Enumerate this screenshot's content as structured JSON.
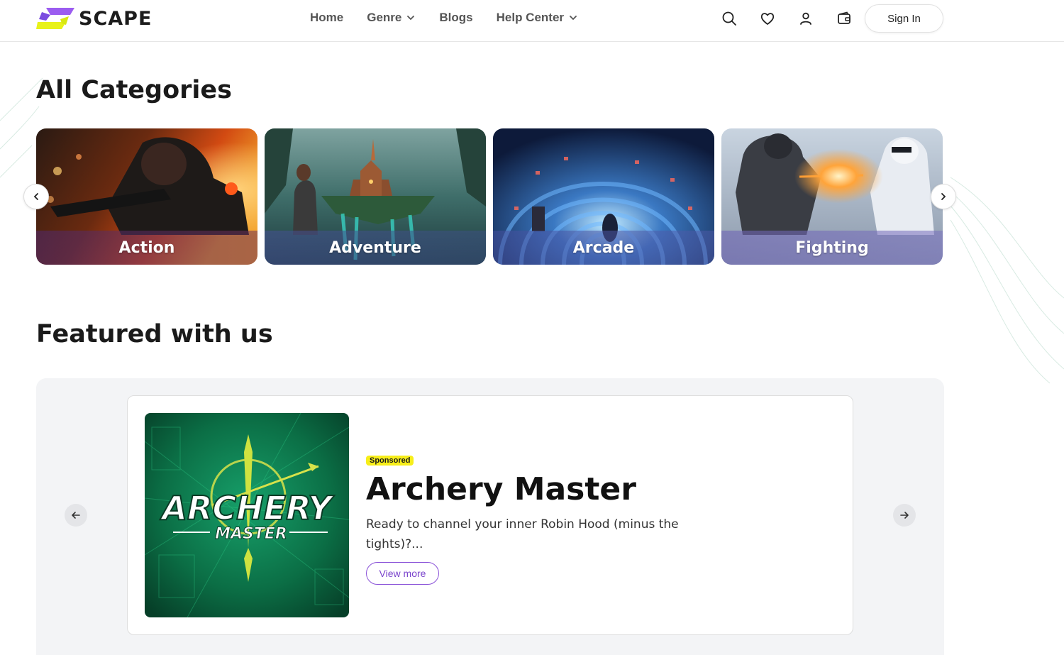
{
  "header": {
    "logo_text": "SCAPE",
    "nav": [
      {
        "label": "Home",
        "has_dropdown": false
      },
      {
        "label": "Genre",
        "has_dropdown": true
      },
      {
        "label": "Blogs",
        "has_dropdown": false
      },
      {
        "label": "Help Center",
        "has_dropdown": true
      }
    ],
    "icons": [
      "search-icon",
      "heart-icon",
      "user-icon",
      "wallet-icon"
    ],
    "signin_label": "Sign In"
  },
  "categories": {
    "title": "All Categories",
    "items": [
      {
        "label": "Action"
      },
      {
        "label": "Adventure"
      },
      {
        "label": "Arcade"
      },
      {
        "label": "Fighting"
      }
    ]
  },
  "featured": {
    "title": "Featured with us",
    "item": {
      "badge": "Sponsored",
      "name": "Archery Master",
      "description": "Ready to channel your inner Robin Hood (minus the tights)?...",
      "button_label": "View more",
      "image_text_line1": "ARCHERY",
      "image_text_line2": "MASTER"
    }
  },
  "colors": {
    "accent_purple": "#8a52d8",
    "badge_yellow": "#f7ee1a",
    "logo_yellow": "#e8f21a",
    "panel_gray": "#f3f4f6"
  }
}
